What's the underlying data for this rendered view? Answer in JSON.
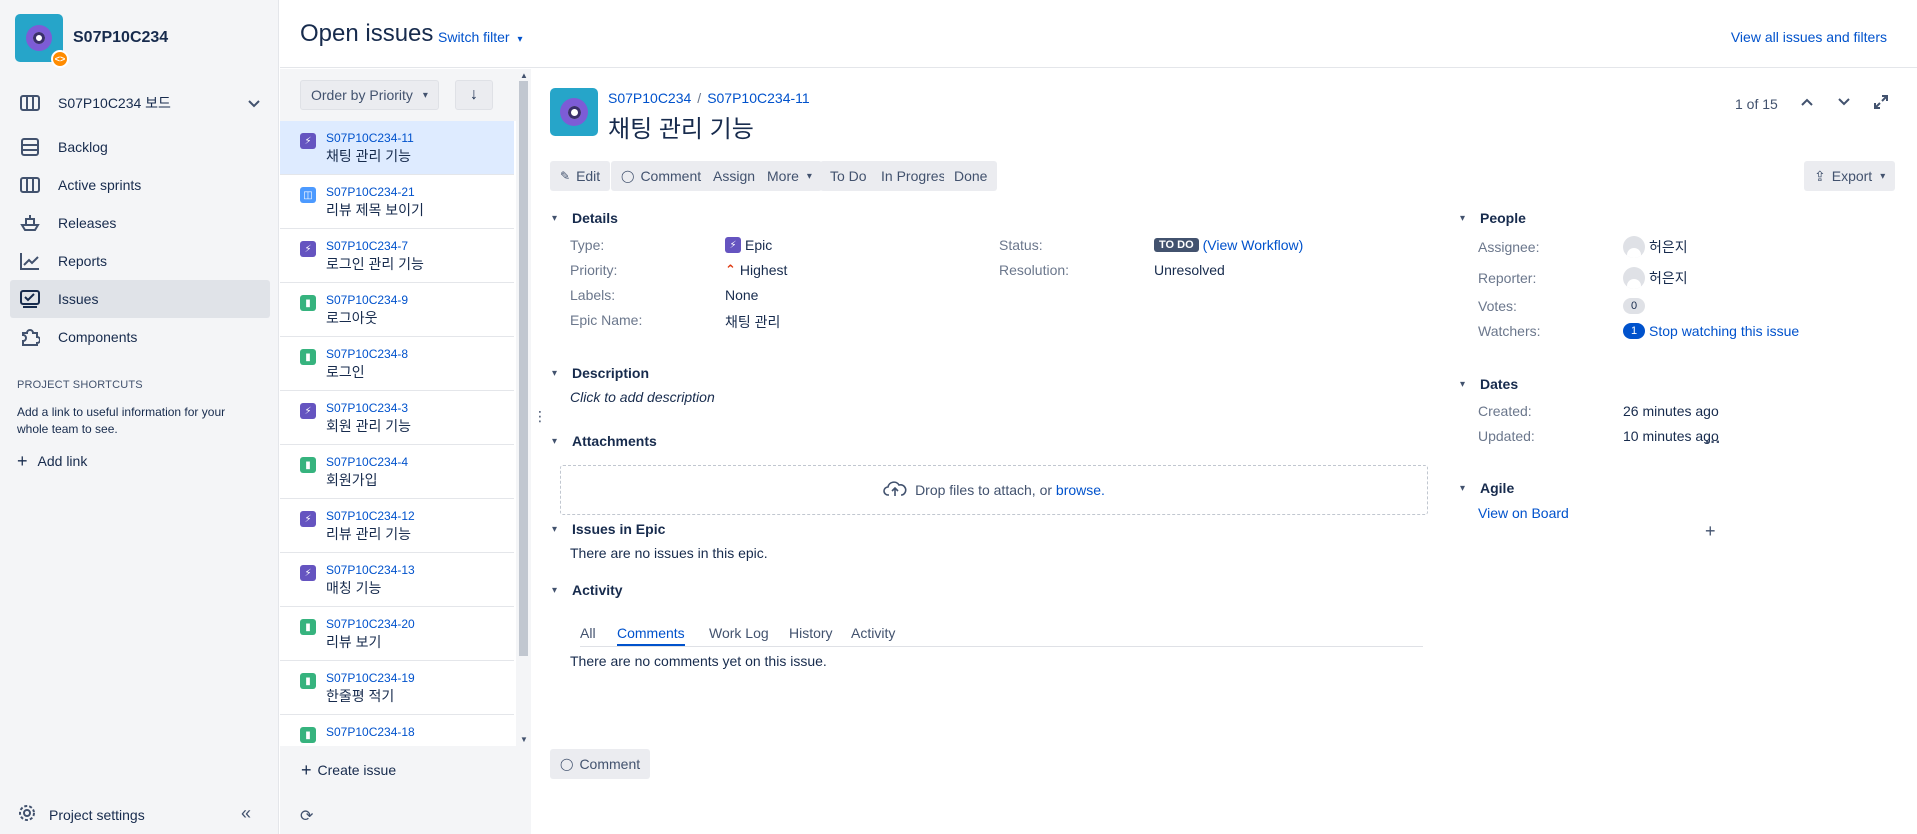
{
  "project": {
    "name": "S07P10C234",
    "board_name": "S07P10C234 보드"
  },
  "sidebar": {
    "items": [
      {
        "label": "Backlog",
        "icon": "backlog-icon"
      },
      {
        "label": "Active sprints",
        "icon": "board-icon"
      },
      {
        "label": "Releases",
        "icon": "ship-icon"
      },
      {
        "label": "Reports",
        "icon": "chart-icon"
      },
      {
        "label": "Issues",
        "icon": "issues-icon"
      },
      {
        "label": "Components",
        "icon": "puzzle-icon"
      }
    ],
    "shortcuts_title": "PROJECT SHORTCUTS",
    "shortcuts_desc": "Add a link to useful information for your whole team to see.",
    "add_link": "Add link",
    "settings": "Project settings"
  },
  "header": {
    "title": "Open issues",
    "switch_filter": "Switch filter",
    "view_all": "View all issues and filters"
  },
  "list": {
    "order_label": "Order by Priority",
    "create_issue": "Create issue",
    "rows": [
      {
        "key": "S07P10C234-11",
        "summary": "채팅 관리 기능",
        "type": "epic"
      },
      {
        "key": "S07P10C234-21",
        "summary": "리뷰 제목 보이기",
        "type": "task"
      },
      {
        "key": "S07P10C234-7",
        "summary": "로그인 관리 기능",
        "type": "epic"
      },
      {
        "key": "S07P10C234-9",
        "summary": "로그아웃",
        "type": "story"
      },
      {
        "key": "S07P10C234-8",
        "summary": "로그인",
        "type": "story"
      },
      {
        "key": "S07P10C234-3",
        "summary": "회원 관리 기능",
        "type": "epic"
      },
      {
        "key": "S07P10C234-4",
        "summary": "회원가입",
        "type": "story"
      },
      {
        "key": "S07P10C234-12",
        "summary": "리뷰 관리 기능",
        "type": "epic"
      },
      {
        "key": "S07P10C234-13",
        "summary": "매칭 기능",
        "type": "epic"
      },
      {
        "key": "S07P10C234-20",
        "summary": "리뷰 보기",
        "type": "story"
      },
      {
        "key": "S07P10C234-19",
        "summary": "한줄평 적기",
        "type": "story"
      },
      {
        "key": "S07P10C234-18",
        "summary": "",
        "type": "story"
      }
    ]
  },
  "detail": {
    "breadcrumb_project": "S07P10C234",
    "breadcrumb_issue": "S07P10C234-11",
    "title": "채팅 관리 기능",
    "pager": "1 of 15",
    "buttons": {
      "edit": "Edit",
      "comment": "Comment",
      "assign": "Assign",
      "more": "More",
      "todo": "To Do",
      "inprogress": "In Progress",
      "done": "Done",
      "export": "Export"
    },
    "sections": {
      "details": "Details",
      "description": "Description",
      "attachments": "Attachments",
      "issues_in_epic": "Issues in Epic",
      "activity": "Activity",
      "people": "People",
      "dates": "Dates",
      "agile": "Agile"
    },
    "fields": {
      "type_label": "Type:",
      "type_value": "Epic",
      "priority_label": "Priority:",
      "priority_value": "Highest",
      "labels_label": "Labels:",
      "labels_value": "None",
      "epic_name_label": "Epic Name:",
      "epic_name_value": "채팅 관리",
      "status_label": "Status:",
      "status_value": "TO DO",
      "view_workflow": "(View Workflow)",
      "resolution_label": "Resolution:",
      "resolution_value": "Unresolved"
    },
    "description_placeholder": "Click to add description",
    "attachments_drop": "Drop files to attach, or",
    "attachments_browse": "browse.",
    "no_issues_in_epic": "There are no issues in this epic.",
    "activity_tabs": [
      "All",
      "Comments",
      "Work Log",
      "History",
      "Activity"
    ],
    "no_comments": "There are no comments yet on this issue.",
    "comment_button": "Comment",
    "people": {
      "assignee_label": "Assignee:",
      "assignee": "허은지",
      "reporter_label": "Reporter:",
      "reporter": "허은지",
      "votes_label": "Votes:",
      "votes": "0",
      "watchers_label": "Watchers:",
      "watchers": "1",
      "stop_watching": "Stop watching this issue"
    },
    "dates": {
      "created_label": "Created:",
      "created": "26 minutes ago",
      "updated_label": "Updated:",
      "updated": "10 minutes ago"
    },
    "agile": {
      "view_on_board": "View on Board"
    }
  },
  "colors": {
    "accent": "#0052cc",
    "epic": "#6554c0",
    "story": "#36b37e",
    "task": "#4c9aff",
    "priority_highest": "#de350b",
    "sidebar_bg": "#f4f5f7",
    "selected_row": "#deebff"
  }
}
